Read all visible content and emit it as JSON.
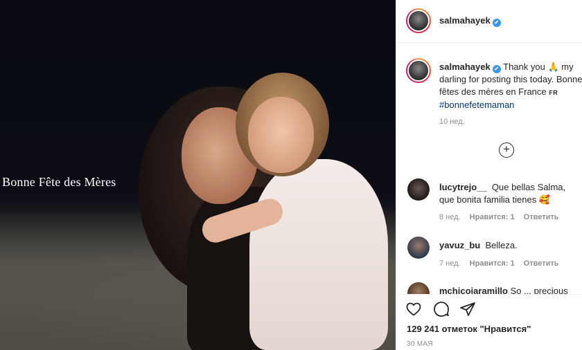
{
  "photo": {
    "overlay_text": "Bonne Fête des Mères"
  },
  "post": {
    "username": "salmahayek",
    "verified_mark": "✔",
    "caption_line1": "Thank you 🙏 my",
    "caption_line2": "darling for posting this today. Bonne",
    "caption_line3": "fêtes des mères en France",
    "caption_lang": "FR",
    "hashtag": "#bonnefetemaman",
    "time_ago": "10 нед.",
    "load_more_symbol": "+"
  },
  "comments": [
    {
      "username": "lucytrejo__",
      "text": "Que bellas Salma, que bonita familia tienes 🥰",
      "time_ago": "8 нед.",
      "likes": "Нравится: 1",
      "reply": "Ответить"
    },
    {
      "username": "yavuz_bu",
      "text": "Belleza.",
      "time_ago": "7 нед.",
      "likes": "Нравится: 1",
      "reply": "Ответить"
    },
    {
      "username": "mchicoiaramillo",
      "text": "So ... precious"
    }
  ],
  "actions": {
    "likes_count": "129 241 отметок \"Нравится\"",
    "date": "30 МАЯ"
  },
  "colors": {
    "verified": "#3897f0",
    "hashtag": "#00376b",
    "muted": "#8e8e8e"
  },
  "icons": [
    "heart-icon",
    "comment-icon",
    "share-icon",
    "add-circle-icon",
    "verified-icon"
  ]
}
